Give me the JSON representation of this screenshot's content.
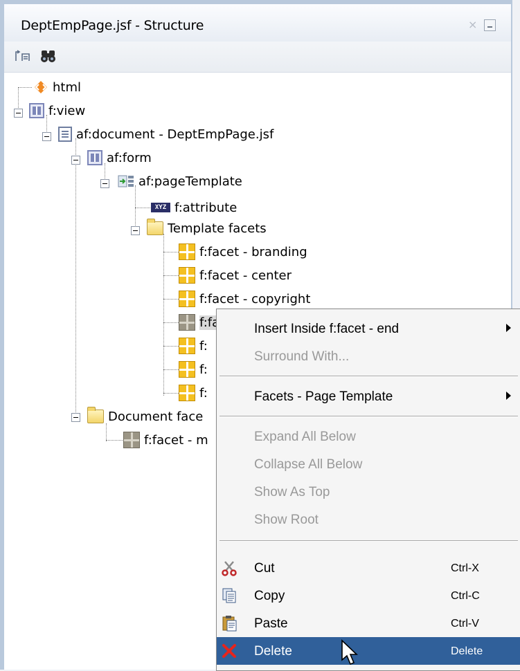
{
  "panel": {
    "title": "DeptEmpPage.jsf - Structure",
    "close_glyph": "×"
  },
  "tree": {
    "html": "html",
    "fview": "f:view",
    "afdocument": "af:document - DeptEmpPage.jsf",
    "afform": "af:form",
    "afpagetemplate": "af:pageTemplate",
    "fattribute": "f:attribute",
    "attr_icon_text": "XYZ",
    "template_facets": "Template facets",
    "facet_branding": "f:facet - branding",
    "facet_center": "f:facet - center",
    "facet_copyright": "f:facet - copyright",
    "facet_end": "f:facet - end",
    "facet_5": "f:",
    "facet_6": "f:",
    "facet_7": "f:",
    "document_facets": "Document face",
    "facet_m": "f:facet - m"
  },
  "menu": {
    "insert_inside": "Insert Inside f:facet - end",
    "surround_with": "Surround With...",
    "facets_template": "Facets - Page Template",
    "expand_all": "Expand All Below",
    "collapse_all": "Collapse All Below",
    "show_as_top": "Show As Top",
    "show_root": "Show Root",
    "cut": "Cut",
    "cut_sc": "Ctrl-X",
    "copy": "Copy",
    "copy_sc": "Ctrl-C",
    "paste": "Paste",
    "paste_sc": "Ctrl-V",
    "delete": "Delete",
    "delete_sc": "Delete"
  },
  "colors": {
    "highlight": "#30609a",
    "panel_border": "#b9c9dc"
  }
}
